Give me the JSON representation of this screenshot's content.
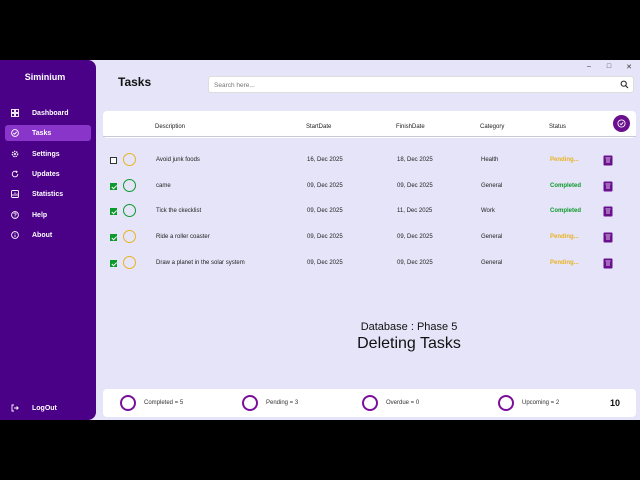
{
  "window": {
    "minimize": "–",
    "maximize": "□",
    "close": "✕"
  },
  "sidebar": {
    "brand": "Siminium",
    "items": [
      {
        "label": "Dashboard",
        "icon": "dashboard-icon"
      },
      {
        "label": "Tasks",
        "icon": "tasks-icon",
        "active": true
      },
      {
        "label": "Settings",
        "icon": "gear-icon"
      },
      {
        "label": "Updates",
        "icon": "updates-icon"
      },
      {
        "label": "Statistics",
        "icon": "statistics-icon"
      },
      {
        "label": "Help",
        "icon": "help-icon"
      },
      {
        "label": "About",
        "icon": "info-icon"
      }
    ],
    "logout": "LogOut"
  },
  "header": {
    "title": "Tasks",
    "search_placeholder": "Search here..."
  },
  "table": {
    "columns": [
      "Description",
      "StartDate",
      "FinishDate",
      "Category",
      "Status"
    ],
    "rows": [
      {
        "checked": false,
        "description": "Avoid junk foods",
        "start": "16, Dec 2025",
        "finish": "18, Dec 2025",
        "category": "Health",
        "status": "Pending..."
      },
      {
        "checked": true,
        "description": "came",
        "start": "09, Dec 2025",
        "finish": "09, Dec 2025",
        "category": "General",
        "status": "Completed"
      },
      {
        "checked": true,
        "description": "Tick the ckecklist",
        "start": "09, Dec 2025",
        "finish": "11, Dec 2025",
        "category": "Work",
        "status": "Completed"
      },
      {
        "checked": true,
        "description": "Ride a roller coaster",
        "start": "09, Dec 2025",
        "finish": "09, Dec 2025",
        "category": "General",
        "status": "Pending..."
      },
      {
        "checked": true,
        "description": "Draw a planet in the solar system",
        "start": "09, Dec 2025",
        "finish": "09, Dec 2025",
        "category": "General",
        "status": "Pending..."
      }
    ]
  },
  "caption": {
    "subtitle": "Database : Phase 5",
    "title": "Deleting Tasks"
  },
  "footer": {
    "completed": "Completed = 5",
    "pending": "Pending = 3",
    "overdue": "Overdue = 0",
    "upcoming": "Upcoming = 2",
    "total": "10"
  },
  "colors": {
    "sidebar": "#4a0087",
    "active_item": "#8a35c9",
    "accent": "#6a0f8e",
    "completed": "#0c9a2c",
    "pending": "#e8b322",
    "background": "#e6e4f8"
  }
}
